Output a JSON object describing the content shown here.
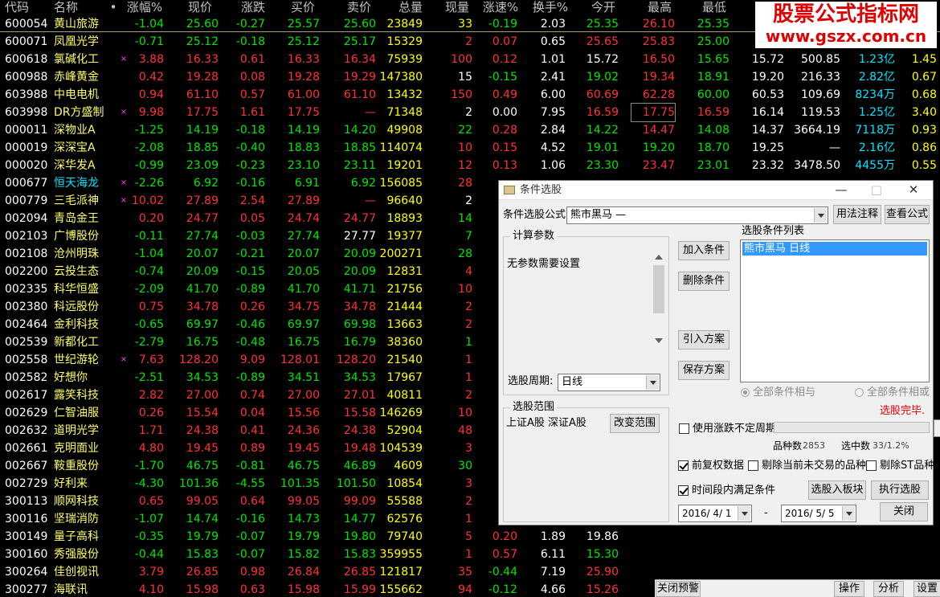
{
  "colors": {
    "up": "#ff3232",
    "down": "#00e600",
    "flat": "#ffffff",
    "yellow": "#ffff00",
    "cyan": "#00e5ff",
    "code": "#ffffff",
    "name": "#ffff64",
    "name_highlight": "#00e5ff"
  },
  "headers": {
    "code": "代码",
    "name": "名称",
    "dot": "•",
    "pct": "涨幅%",
    "price": "现价",
    "change": "涨跌",
    "bid": "买价",
    "ask": "卖价",
    "volume": "总量",
    "cur_vol": "现量",
    "speed": "涨速%",
    "turnover": "换手%",
    "open": "今开",
    "high": "最高",
    "low": "最低"
  },
  "stocks": [
    {
      "code": "600054",
      "name": "黄山旅游",
      "mark": "",
      "pct": "-1.04",
      "price": "25.60",
      "change": "-0.27",
      "bid": "25.57",
      "ask": "25.60",
      "volume": "23849",
      "cur": "33",
      "speed": "-0.19",
      "turn": "2.03",
      "open": "25.35",
      "high": "26.10",
      "low": "25.35",
      "c1": "",
      "c2": "",
      "c3": "",
      "c4": "",
      "sc": "down",
      "tc": "yellow",
      "cc": "yellow",
      "oc": "down",
      "hc": "up",
      "lc": "down",
      "scc": "down"
    },
    {
      "code": "600071",
      "name": "凤凰光学",
      "mark": "",
      "pct": "-0.71",
      "price": "25.12",
      "change": "-0.18",
      "bid": "25.12",
      "ask": "25.17",
      "volume": "15329",
      "cur": "2",
      "speed": "0.07",
      "turn": "0.65",
      "open": "25.65",
      "high": "25.83",
      "low": "25.00",
      "c1": "",
      "c2": "",
      "c3": "",
      "c4": "",
      "sc": "down",
      "tc": "flat",
      "cc": "up",
      "oc": "up",
      "hc": "up",
      "lc": "down",
      "scc": "up"
    },
    {
      "code": "600618",
      "name": "氯碱化工",
      "mark": "×",
      "pct": "3.88",
      "price": "16.33",
      "change": "0.61",
      "bid": "16.33",
      "ask": "16.34",
      "volume": "75939",
      "cur": "100",
      "speed": "0.12",
      "turn": "1.01",
      "open": "15.72",
      "high": "16.50",
      "low": "15.65",
      "c1": "15.72",
      "c2": "500.85",
      "c3": "1.23亿",
      "c4": "1.45",
      "sc": "up",
      "tc": "flat",
      "cc": "up",
      "oc": "flat",
      "hc": "up",
      "lc": "down",
      "scc": "up"
    },
    {
      "code": "600988",
      "name": "赤峰黄金",
      "mark": "",
      "pct": "0.42",
      "price": "19.28",
      "change": "0.08",
      "bid": "19.28",
      "ask": "19.29",
      "volume": "147380",
      "cur": "15",
      "speed": "-0.15",
      "turn": "2.41",
      "open": "19.02",
      "high": "19.34",
      "low": "18.91",
      "c1": "19.20",
      "c2": "216.33",
      "c3": "2.82亿",
      "c4": "0.67",
      "sc": "up",
      "tc": "flat",
      "cc": "flat",
      "oc": "down",
      "hc": "up",
      "lc": "down",
      "scc": "down"
    },
    {
      "code": "603988",
      "name": "中电电机",
      "mark": "",
      "pct": "0.94",
      "price": "61.10",
      "change": "0.57",
      "bid": "61.00",
      "ask": "61.10",
      "volume": "13432",
      "cur": "150",
      "speed": "0.49",
      "turn": "6.00",
      "open": "60.69",
      "high": "62.28",
      "low": "60.00",
      "c1": "60.53",
      "c2": "109.69",
      "c3": "8234万",
      "c4": "0.68",
      "sc": "up",
      "tc": "flat",
      "cc": "up",
      "oc": "up",
      "hc": "up",
      "lc": "down",
      "scc": "up"
    },
    {
      "code": "603998",
      "name": "DR方盛制",
      "mark": "×",
      "pct": "9.98",
      "price": "17.75",
      "change": "1.61",
      "bid": "17.75",
      "ask": "—",
      "volume": "71348",
      "cur": "2",
      "speed": "0.00",
      "turn": "7.95",
      "open": "16.59",
      "high": "17.75",
      "low": "16.59",
      "c1": "16.14",
      "c2": "119.53",
      "c3": "1.25亿",
      "c4": "3.40",
      "sc": "up",
      "tc": "flat",
      "cc": "flat",
      "oc": "up",
      "hc": "up",
      "lc": "up",
      "scc": "flat",
      "boxhigh": true
    },
    {
      "code": "000011",
      "name": "深物业A",
      "mark": "",
      "pct": "-1.25",
      "price": "14.19",
      "change": "-0.18",
      "bid": "14.19",
      "ask": "14.20",
      "volume": "49908",
      "cur": "22",
      "speed": "0.28",
      "turn": "2.84",
      "open": "14.22",
      "high": "14.47",
      "low": "14.08",
      "c1": "14.37",
      "c2": "3664.19",
      "c3": "7118万",
      "c4": "0.93",
      "sc": "down",
      "tc": "flat",
      "cc": "down",
      "oc": "down",
      "hc": "up",
      "lc": "down",
      "scc": "up"
    },
    {
      "code": "000019",
      "name": "深深宝A",
      "mark": "",
      "pct": "-2.08",
      "price": "18.85",
      "change": "-0.40",
      "bid": "18.83",
      "ask": "18.85",
      "volume": "114074",
      "cur": "10",
      "speed": "0.15",
      "turn": "4.52",
      "open": "19.01",
      "high": "19.20",
      "low": "18.70",
      "c1": "19.25",
      "c2": "—",
      "c3": "2.16亿",
      "c4": "0.86",
      "sc": "down",
      "tc": "flat",
      "cc": "up",
      "oc": "down",
      "hc": "down",
      "lc": "down",
      "scc": "up"
    },
    {
      "code": "000020",
      "name": "深华发A",
      "mark": "",
      "pct": "-0.99",
      "price": "23.09",
      "change": "-0.23",
      "bid": "23.10",
      "ask": "23.11",
      "volume": "19201",
      "cur": "12",
      "speed": "0.13",
      "turn": "1.06",
      "open": "23.30",
      "high": "23.47",
      "low": "23.01",
      "c1": "23.32",
      "c2": "3478.50",
      "c3": "4455万",
      "c4": "0.55",
      "sc": "down",
      "tc": "flat",
      "cc": "up",
      "oc": "down",
      "hc": "up",
      "lc": "down",
      "scc": "up"
    },
    {
      "code": "000677",
      "name": "恒天海龙",
      "mark": "×",
      "pct": "-2.26",
      "price": "6.92",
      "change": "-0.16",
      "bid": "6.91",
      "ask": "6.92",
      "volume": "156085",
      "cur": "28",
      "speed": "",
      "turn": "",
      "open": "",
      "high": "",
      "low": "",
      "c1": "",
      "c2": "",
      "c3": "",
      "c4": "",
      "sc": "down",
      "tc": "flat",
      "cc": "up",
      "oc": "down",
      "hc": "up",
      "lc": "down",
      "scc": "up",
      "hl": true
    },
    {
      "code": "000779",
      "name": "三毛派神",
      "mark": "×",
      "pct": "10.02",
      "price": "27.89",
      "change": "2.54",
      "bid": "27.89",
      "ask": "—",
      "volume": "96640",
      "cur": "2",
      "speed": "",
      "turn": "",
      "open": "",
      "high": "",
      "low": "",
      "c1": "",
      "c2": "",
      "c3": "",
      "c4": "",
      "sc": "up",
      "tc": "flat",
      "cc": "flat",
      "oc": "up",
      "hc": "up",
      "lc": "up",
      "scc": "flat"
    },
    {
      "code": "002094",
      "name": "青岛金王",
      "mark": "",
      "pct": "0.20",
      "price": "24.77",
      "change": "0.05",
      "bid": "24.74",
      "ask": "24.77",
      "volume": "18893",
      "cur": "14",
      "speed": "",
      "turn": "",
      "open": "",
      "high": "",
      "low": "",
      "c1": "",
      "c2": "",
      "c3": "",
      "c4": "",
      "sc": "up",
      "tc": "flat",
      "cc": "down",
      "oc": "up",
      "hc": "up",
      "lc": "up",
      "scc": "up"
    },
    {
      "code": "002103",
      "name": "广博股份",
      "mark": "",
      "pct": "-0.11",
      "price": "27.74",
      "change": "-0.03",
      "bid": "27.74",
      "ask": "27.77",
      "volume": "19377",
      "cur": "7",
      "speed": "",
      "turn": "",
      "open": "",
      "high": "",
      "low": "",
      "c1": "",
      "c2": "",
      "c3": "",
      "c4": "",
      "sc": "down",
      "tc": "flat",
      "cc": "down",
      "oc": "down",
      "hc": "up",
      "lc": "down",
      "scc": "up",
      "askflat": true
    },
    {
      "code": "002108",
      "name": "沧州明珠",
      "mark": "",
      "pct": "-1.04",
      "price": "20.07",
      "change": "-0.21",
      "bid": "20.07",
      "ask": "20.09",
      "volume": "200271",
      "cur": "28",
      "speed": "",
      "turn": "",
      "open": "",
      "high": "",
      "low": "",
      "c1": "",
      "c2": "",
      "c3": "",
      "c4": "",
      "sc": "down",
      "tc": "flat",
      "cc": "down",
      "oc": "down",
      "hc": "up",
      "lc": "down",
      "scc": "up"
    },
    {
      "code": "002200",
      "name": "云投生态",
      "mark": "",
      "pct": "-0.74",
      "price": "20.09",
      "change": "-0.15",
      "bid": "20.05",
      "ask": "20.09",
      "volume": "12831",
      "cur": "4",
      "speed": "",
      "turn": "",
      "open": "",
      "high": "",
      "low": "",
      "c1": "",
      "c2": "",
      "c3": "",
      "c4": "",
      "sc": "down",
      "tc": "flat",
      "cc": "up",
      "oc": "down",
      "hc": "up",
      "lc": "down",
      "scc": "up"
    },
    {
      "code": "002335",
      "name": "科华恒盛",
      "mark": "",
      "pct": "-2.09",
      "price": "41.70",
      "change": "-0.89",
      "bid": "41.70",
      "ask": "41.71",
      "volume": "21756",
      "cur": "10",
      "speed": "",
      "turn": "",
      "open": "",
      "high": "",
      "low": "",
      "c1": "",
      "c2": "",
      "c3": "",
      "c4": "",
      "sc": "down",
      "tc": "flat",
      "cc": "up",
      "oc": "down",
      "hc": "up",
      "lc": "down",
      "scc": "up"
    },
    {
      "code": "002380",
      "name": "科远股份",
      "mark": "",
      "pct": "0.75",
      "price": "34.78",
      "change": "0.26",
      "bid": "34.75",
      "ask": "34.78",
      "volume": "21444",
      "cur": "2",
      "speed": "",
      "turn": "",
      "open": "",
      "high": "",
      "low": "",
      "c1": "",
      "c2": "",
      "c3": "",
      "c4": "",
      "sc": "up",
      "tc": "flat",
      "cc": "up",
      "oc": "up",
      "hc": "up",
      "lc": "up",
      "scc": "up"
    },
    {
      "code": "002464",
      "name": "金利科技",
      "mark": "",
      "pct": "-0.65",
      "price": "69.97",
      "change": "-0.46",
      "bid": "69.97",
      "ask": "69.98",
      "volume": "13663",
      "cur": "2",
      "speed": "",
      "turn": "",
      "open": "",
      "high": "",
      "low": "",
      "c1": "",
      "c2": "",
      "c3": "",
      "c4": "",
      "sc": "down",
      "tc": "flat",
      "cc": "up",
      "oc": "down",
      "hc": "up",
      "lc": "down",
      "scc": "up"
    },
    {
      "code": "002539",
      "name": "新都化工",
      "mark": "",
      "pct": "-2.79",
      "price": "16.75",
      "change": "-0.48",
      "bid": "16.75",
      "ask": "16.79",
      "volume": "38360",
      "cur": "1",
      "speed": "",
      "turn": "",
      "open": "",
      "high": "",
      "low": "",
      "c1": "",
      "c2": "",
      "c3": "",
      "c4": "",
      "sc": "down",
      "tc": "flat",
      "cc": "down",
      "oc": "down",
      "hc": "up",
      "lc": "down",
      "scc": "up"
    },
    {
      "code": "002558",
      "name": "世纪游轮",
      "mark": "×",
      "pct": "7.63",
      "price": "128.20",
      "change": "9.09",
      "bid": "128.01",
      "ask": "128.20",
      "volume": "21540",
      "cur": "1",
      "speed": "",
      "turn": "",
      "open": "",
      "high": "",
      "low": "",
      "c1": "",
      "c2": "",
      "c3": "",
      "c4": "",
      "sc": "up",
      "tc": "flat",
      "cc": "up",
      "oc": "up",
      "hc": "up",
      "lc": "up",
      "scc": "up"
    },
    {
      "code": "002582",
      "name": "好想你",
      "mark": "",
      "pct": "-2.51",
      "price": "34.53",
      "change": "-0.89",
      "bid": "34.51",
      "ask": "34.53",
      "volume": "17967",
      "cur": "1",
      "speed": "",
      "turn": "",
      "open": "",
      "high": "",
      "low": "",
      "c1": "",
      "c2": "",
      "c3": "",
      "c4": "",
      "sc": "down",
      "tc": "flat",
      "cc": "up",
      "oc": "down",
      "hc": "up",
      "lc": "down",
      "scc": "up"
    },
    {
      "code": "002617",
      "name": "露笑科技",
      "mark": "",
      "pct": "2.82",
      "price": "27.00",
      "change": "0.74",
      "bid": "27.00",
      "ask": "27.01",
      "volume": "40811",
      "cur": "2",
      "speed": "",
      "turn": "",
      "open": "",
      "high": "",
      "low": "",
      "c1": "",
      "c2": "",
      "c3": "",
      "c4": "",
      "sc": "up",
      "tc": "flat",
      "cc": "up",
      "oc": "up",
      "hc": "up",
      "lc": "up",
      "scc": "up"
    },
    {
      "code": "002629",
      "name": "仁智油服",
      "mark": "",
      "pct": "0.26",
      "price": "15.54",
      "change": "0.04",
      "bid": "15.56",
      "ask": "15.58",
      "volume": "146269",
      "cur": "10",
      "speed": "",
      "turn": "",
      "open": "",
      "high": "",
      "low": "",
      "c1": "",
      "c2": "",
      "c3": "",
      "c4": "",
      "sc": "up",
      "tc": "flat",
      "cc": "up",
      "oc": "up",
      "hc": "up",
      "lc": "up",
      "scc": "down"
    },
    {
      "code": "002632",
      "name": "道明光学",
      "mark": "",
      "pct": "1.71",
      "price": "24.38",
      "change": "0.41",
      "bid": "24.36",
      "ask": "24.38",
      "volume": "52904",
      "cur": "48",
      "speed": "",
      "turn": "",
      "open": "",
      "high": "",
      "low": "",
      "c1": "",
      "c2": "",
      "c3": "",
      "c4": "",
      "sc": "up",
      "tc": "flat",
      "cc": "up",
      "oc": "up",
      "hc": "up",
      "lc": "up",
      "scc": "up"
    },
    {
      "code": "002661",
      "name": "克明面业",
      "mark": "",
      "pct": "4.80",
      "price": "19.45",
      "change": "0.89",
      "bid": "19.45",
      "ask": "19.48",
      "volume": "104539",
      "cur": "3",
      "speed": "",
      "turn": "",
      "open": "",
      "high": "",
      "low": "",
      "c1": "",
      "c2": "",
      "c3": "",
      "c4": "",
      "sc": "up",
      "tc": "flat",
      "cc": "up",
      "oc": "up",
      "hc": "up",
      "lc": "up",
      "scc": "down"
    },
    {
      "code": "002667",
      "name": "鞍重股份",
      "mark": "",
      "pct": "-1.70",
      "price": "46.75",
      "change": "-0.81",
      "bid": "46.75",
      "ask": "46.89",
      "volume": "4609",
      "cur": "30",
      "speed": "",
      "turn": "",
      "open": "",
      "high": "",
      "low": "",
      "c1": "",
      "c2": "",
      "c3": "",
      "c4": "",
      "sc": "down",
      "tc": "flat",
      "cc": "down",
      "oc": "down",
      "hc": "up",
      "lc": "down",
      "scc": "down"
    },
    {
      "code": "002729",
      "name": "好利来",
      "mark": "",
      "pct": "-4.30",
      "price": "101.36",
      "change": "-4.55",
      "bid": "101.35",
      "ask": "101.50",
      "volume": "10854",
      "cur": "3",
      "speed": "",
      "turn": "",
      "open": "",
      "high": "",
      "low": "",
      "c1": "",
      "c2": "",
      "c3": "",
      "c4": "",
      "sc": "down",
      "tc": "flat",
      "cc": "up",
      "oc": "down",
      "hc": "up",
      "lc": "down",
      "scc": "down"
    },
    {
      "code": "300113",
      "name": "顺网科技",
      "mark": "",
      "pct": "0.65",
      "price": "99.05",
      "change": "0.64",
      "bid": "99.05",
      "ask": "99.09",
      "volume": "55588",
      "cur": "2",
      "speed": "",
      "turn": "",
      "open": "",
      "high": "",
      "low": "",
      "c1": "",
      "c2": "",
      "c3": "",
      "c4": "",
      "sc": "up",
      "tc": "flat",
      "cc": "up",
      "oc": "up",
      "hc": "up",
      "lc": "up",
      "scc": "up"
    },
    {
      "code": "300116",
      "name": "坚瑞消防",
      "mark": "",
      "pct": "-1.07",
      "price": "14.74",
      "change": "-0.16",
      "bid": "14.73",
      "ask": "14.77",
      "volume": "62576",
      "cur": "1",
      "speed": "",
      "turn": "",
      "open": "",
      "high": "",
      "low": "",
      "c1": "",
      "c2": "",
      "c3": "",
      "c4": "",
      "sc": "down",
      "tc": "flat",
      "cc": "up",
      "oc": "down",
      "hc": "up",
      "lc": "down",
      "scc": "down"
    },
    {
      "code": "300149",
      "name": "量子高科",
      "mark": "",
      "pct": "-0.35",
      "price": "19.79",
      "change": "-0.07",
      "bid": "19.79",
      "ask": "19.80",
      "volume": "79740",
      "cur": "5",
      "speed": "0.20",
      "turn": "1.89",
      "open": "19.86",
      "high": "",
      "low": "",
      "c1": "",
      "c2": "",
      "c3": "",
      "c4": "",
      "sc": "down",
      "tc": "flat",
      "cc": "up",
      "oc": "flat",
      "hc": "up",
      "lc": "down",
      "scc": "up"
    },
    {
      "code": "300160",
      "name": "秀强股份",
      "mark": "",
      "pct": "-0.44",
      "price": "15.83",
      "change": "-0.07",
      "bid": "15.82",
      "ask": "15.83",
      "volume": "359955",
      "cur": "1",
      "speed": "0.57",
      "turn": "6.11",
      "open": "15.30",
      "high": "",
      "low": "",
      "c1": "",
      "c2": "",
      "c3": "",
      "c4": "",
      "sc": "down",
      "tc": "flat",
      "cc": "up",
      "oc": "down",
      "hc": "up",
      "lc": "down",
      "scc": "up"
    },
    {
      "code": "300264",
      "name": "佳创视讯",
      "mark": "",
      "pct": "3.79",
      "price": "26.85",
      "change": "0.98",
      "bid": "26.84",
      "ask": "26.85",
      "volume": "121817",
      "cur": "35",
      "speed": "-0.44",
      "turn": "7.19",
      "open": "25.90",
      "high": "",
      "low": "",
      "c1": "",
      "c2": "",
      "c3": "",
      "c4": "",
      "sc": "up",
      "tc": "flat",
      "cc": "up",
      "oc": "up",
      "hc": "up",
      "lc": "up",
      "scc": "down"
    },
    {
      "code": "300277",
      "name": "海联讯",
      "mark": "",
      "pct": "4.10",
      "price": "15.98",
      "change": "0.63",
      "bid": "15.98",
      "ask": "15.99",
      "volume": "155662",
      "cur": "94",
      "speed": "-0.12",
      "turn": "4.66",
      "open": "15.26",
      "high": "",
      "low": "",
      "c1": "",
      "c2": "",
      "c3": "",
      "c4": "",
      "sc": "up",
      "tc": "flat",
      "cc": "up",
      "oc": "up",
      "hc": "up",
      "lc": "up",
      "scc": "down"
    }
  ],
  "watermark": {
    "line1": "股票公式指标网",
    "line2": "www.gszx.com.cn"
  },
  "dialog": {
    "title": "条件选股",
    "formula_label": "条件选股公式",
    "formula_value": "熊市黑马    —",
    "btn_usage": "用法注释",
    "btn_view": "查看公式",
    "params_group": "计算参数",
    "params_text": "无参数需要设置",
    "period_label": "选股周期:",
    "period_value": "日线",
    "btn_add": "加入条件",
    "btn_delete": "删除条件",
    "btn_import": "引入方案",
    "btn_save": "保存方案",
    "list_label": "选股条件列表",
    "list_item": "熊市黑马  日线",
    "radio_and": "全部条件相与",
    "radio_or": "全部条件相或",
    "status": "选股完毕.",
    "scope_group": "选股范围",
    "scope_text": "上证A股 深证A股",
    "btn_change_scope": "改变范围",
    "chk_period": "使用涨跌不定周期",
    "count_label": "品种数",
    "count_value": "2853",
    "selected_label": "选中数",
    "selected_value": "33/1.2%",
    "chk_adjust": "前复权数据",
    "chk_exclude_untraded": "剔除当前未交易的品种",
    "chk_exclude_st": "剔除ST品种",
    "chk_time_range": "时间段内满足条件",
    "btn_to_block": "选股入板块",
    "btn_execute": "执行选股",
    "date_from": "2016/ 4/ 1",
    "date_sep": "-",
    "date_to": "2016/ 5/ 5",
    "btn_close": "关闭",
    "wbtn_min": "—",
    "wbtn_max": "□",
    "wbtn_close": "✕"
  },
  "bottom_bar": {
    "close_alert": "关闭预警",
    "ops": "操作",
    "analysis": "分析",
    "settings": "设置"
  }
}
